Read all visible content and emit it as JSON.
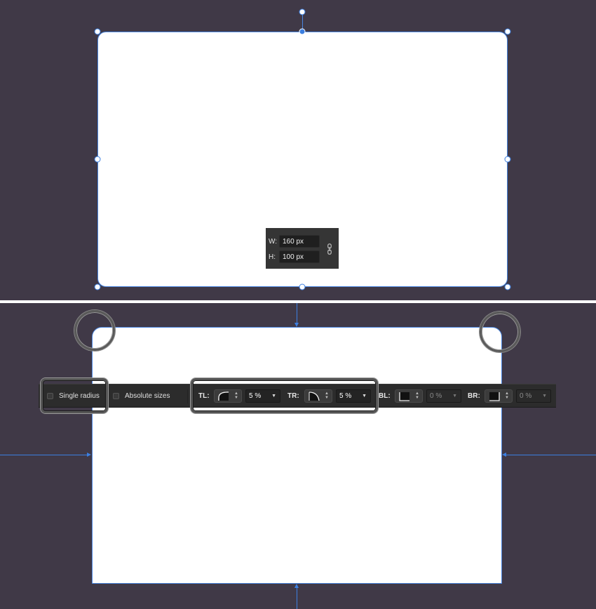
{
  "top_panel": {
    "size_popup": {
      "width_label": "W:",
      "width_value": "160 px",
      "height_label": "H:",
      "height_value": "100 px",
      "link_icon": "chain-link-icon"
    }
  },
  "toolbar": {
    "single_radius_label": "Single radius",
    "absolute_sizes_label": "Absolute sizes",
    "corners": [
      {
        "label": "TL:",
        "value": "5 %",
        "icon": "rounded-corner-icon"
      },
      {
        "label": "TR:",
        "value": "5 %",
        "icon": "concave-corner-icon"
      },
      {
        "label": "BL:",
        "value": "0 %",
        "icon": "square-corner-icon"
      },
      {
        "label": "BR:",
        "value": "0 %",
        "icon": "square-corner-icon"
      }
    ]
  },
  "colors": {
    "canvas_background": "#403947",
    "selection_accent": "#3c7fe0",
    "toolbar_background": "#2c2c2c"
  }
}
